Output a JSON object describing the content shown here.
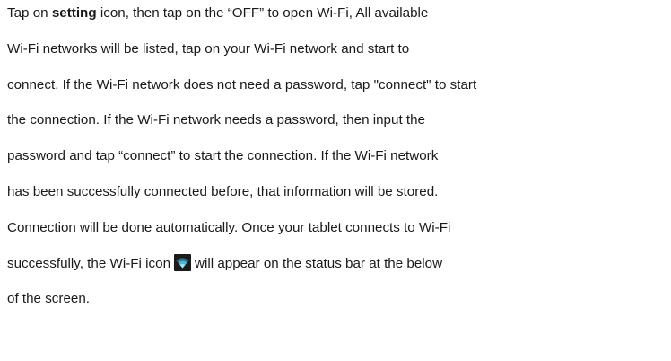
{
  "paragraph": {
    "line1": {
      "pre": "Tap on ",
      "bold": "setting",
      "post": " icon, then tap on the “OFF” to open Wi-Fi, All available"
    },
    "line2": "Wi-Fi networks will be listed, tap on your Wi-Fi network and start to",
    "line3": "connect. If the Wi-Fi network does not need a password, tap \"connect\" to start",
    "line4": "the connection. If the Wi-Fi network needs a password, then input the",
    "line5": "password and tap “connect” to start the connection. If the Wi-Fi network",
    "line6": "has been successfully connected before, that information will be stored.",
    "line7": "Connection will be done automatically. Once your tablet connects to Wi-Fi",
    "line8": {
      "pre": "successfully, the Wi-Fi icon",
      "post": "will appear on the status bar at the below"
    },
    "line9": "of the screen."
  },
  "icons": {
    "wifi": "wifi-icon"
  },
  "colors": {
    "text": "#1a1a1a",
    "background": "#ffffff",
    "icon_background": "#1b1b1b",
    "icon_signal": "#7fd4ec"
  }
}
